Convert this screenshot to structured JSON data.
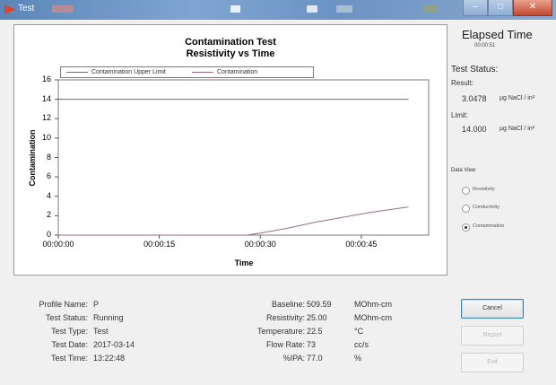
{
  "window": {
    "title": "Test",
    "minimize_label": "–",
    "maximize_label": "□",
    "close_label": "✕"
  },
  "right_panel": {
    "elapsed_heading": "Elapsed Time",
    "elapsed_value": "00:00:51",
    "test_status_heading": "Test Status:",
    "result_label": "Result:",
    "result_value": "3.0478",
    "result_unit": "µg NaCl / in²",
    "limit_label": "Limit:",
    "limit_value": "14.000",
    "limit_unit": "µg NaCl / in²",
    "data_view_heading": "Data View",
    "options": [
      {
        "label": "Resistivity",
        "selected": false
      },
      {
        "label": "Conductivity",
        "selected": false
      },
      {
        "label": "Contamination",
        "selected": true
      }
    ]
  },
  "info_left": [
    {
      "label": "Profile Name:",
      "value": "P"
    },
    {
      "label": "Test Status:",
      "value": "Running"
    },
    {
      "label": "Test Type:",
      "value": "Test"
    },
    {
      "label": "Test Date:",
      "value": "2017-03-14"
    },
    {
      "label": "Test Time:",
      "value": "13:22:48"
    }
  ],
  "info_right": [
    {
      "label": "Baseline:",
      "value": "509.59",
      "unit": "MOhm-cm"
    },
    {
      "label": "Resistivity:",
      "value": "25.00",
      "unit": "MOhm-cm"
    },
    {
      "label": "Temperature:",
      "value": "22.5",
      "unit": "°C"
    },
    {
      "label": "Flow Rate:",
      "value": "73",
      "unit": "cc/s"
    },
    {
      "label": "%IPA:",
      "value": "77.0",
      "unit": "%"
    }
  ],
  "buttons": [
    {
      "label": "Cancel",
      "enabled": true
    },
    {
      "label": "Report",
      "enabled": false
    },
    {
      "label": "Exit",
      "enabled": false
    }
  ],
  "chart_data": {
    "type": "line",
    "title": "Contamination Test",
    "subtitle": "Resistivity vs Time",
    "xlabel": "Time",
    "ylabel": "Contamination",
    "x_tick_labels": [
      "00:00:00",
      "00:00:15",
      "00:00:30",
      "00:00:45"
    ],
    "x_tick_seconds": [
      0,
      15,
      30,
      45
    ],
    "xlim_seconds": [
      0,
      55
    ],
    "ylim": [
      0,
      16
    ],
    "y_ticks": [
      0,
      2,
      4,
      6,
      8,
      10,
      12,
      14,
      16
    ],
    "grid": false,
    "legend_position": "top",
    "series": [
      {
        "name": "Contamination Upper Limit",
        "color": "#6a6a6a",
        "x_seconds": [
          0,
          52
        ],
        "y": [
          14,
          14
        ]
      },
      {
        "name": "Contamination",
        "color": "#9a6a8a",
        "x_seconds": [
          0,
          28,
          30,
          34,
          38,
          42,
          46,
          50,
          52
        ],
        "y": [
          0,
          0,
          0.2,
          0.7,
          1.3,
          1.8,
          2.3,
          2.7,
          2.9
        ]
      }
    ]
  }
}
